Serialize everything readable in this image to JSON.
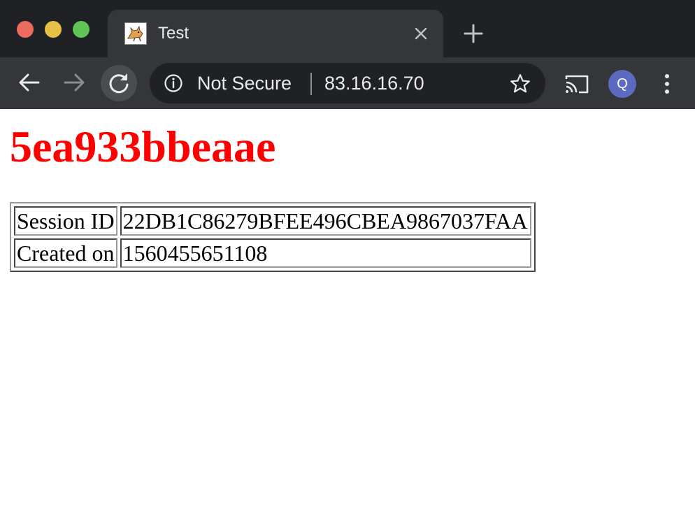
{
  "browser": {
    "tab": {
      "title": "Test",
      "favicon": "tomcat-icon"
    },
    "omnibox": {
      "security_label": "Not Secure",
      "url": "83.16.16.70"
    },
    "profile": {
      "initial": "Q",
      "color": "#5c6bc0"
    }
  },
  "page": {
    "heading": "5ea933bbeaae",
    "heading_color": "#ff0000",
    "table": [
      {
        "label": "Session ID",
        "value": "22DB1C86279BFEE496CBEA9867037FAA"
      },
      {
        "label": "Created on",
        "value": "1560455651108"
      }
    ]
  }
}
